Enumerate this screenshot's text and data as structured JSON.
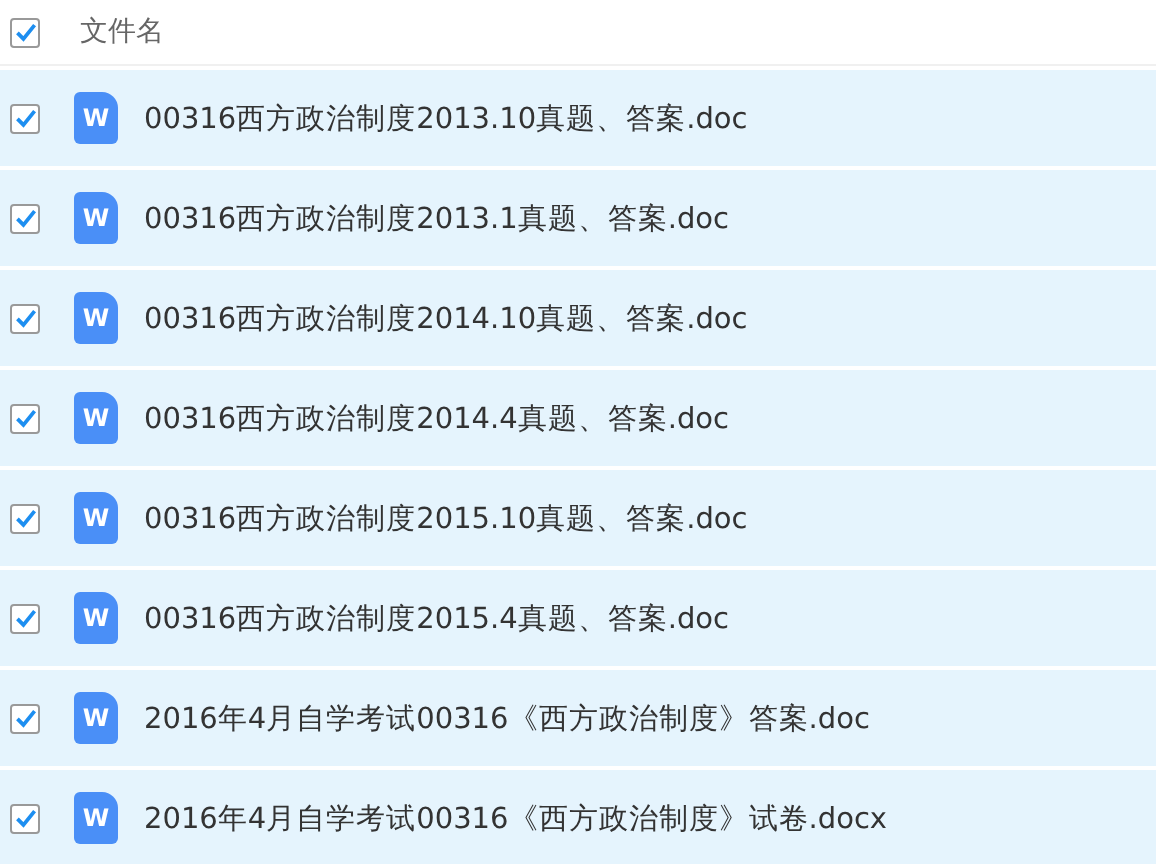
{
  "header": {
    "checked": true,
    "label": "文件名"
  },
  "files": [
    {
      "name": "00316西方政治制度2013.10真题、答案.doc",
      "checked": true,
      "selected": true,
      "icon_text": "W"
    },
    {
      "name": "00316西方政治制度2013.1真题、答案.doc",
      "checked": true,
      "selected": true,
      "icon_text": "W"
    },
    {
      "name": "00316西方政治制度2014.10真题、答案.doc",
      "checked": true,
      "selected": true,
      "icon_text": "W"
    },
    {
      "name": "00316西方政治制度2014.4真题、答案.doc",
      "checked": true,
      "selected": true,
      "icon_text": "W"
    },
    {
      "name": "00316西方政治制度2015.10真题、答案.doc",
      "checked": true,
      "selected": true,
      "icon_text": "W"
    },
    {
      "name": "00316西方政治制度2015.4真题、答案.doc",
      "checked": true,
      "selected": true,
      "icon_text": "W"
    },
    {
      "name": "2016年4月自学考试00316《西方政治制度》答案.doc",
      "checked": true,
      "selected": true,
      "icon_text": "W"
    },
    {
      "name": "2016年4月自学考试00316《西方政治制度》试卷.docx",
      "checked": true,
      "selected": true,
      "icon_text": "W"
    }
  ]
}
